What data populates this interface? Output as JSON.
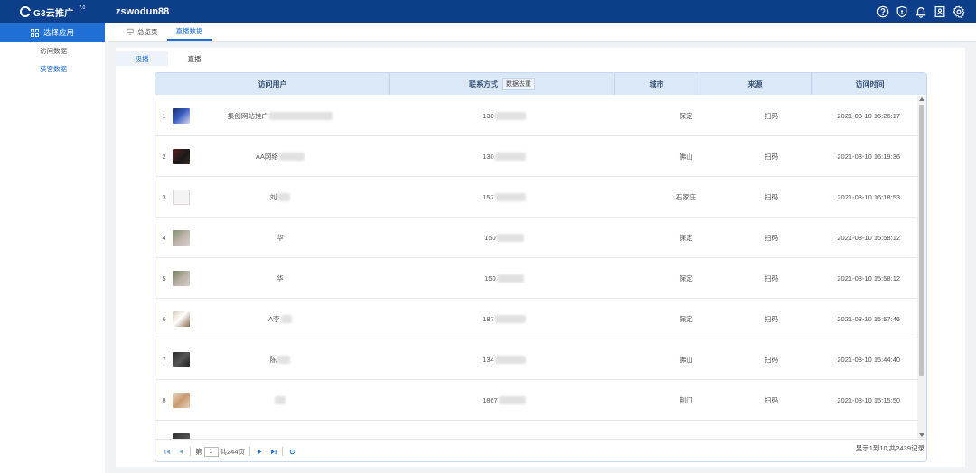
{
  "app": {
    "logo_text": "G3云推广",
    "version": "7.0",
    "account": "zswodun88"
  },
  "header_icons": [
    "help-icon",
    "shield-icon",
    "bell-icon",
    "contacts-icon",
    "gear-icon"
  ],
  "sidebar": {
    "head_label": "选择应用",
    "items": [
      {
        "label": "访问数据",
        "active": false
      },
      {
        "label": "获客数据",
        "active": true
      }
    ]
  },
  "tabs": [
    {
      "label": "总览页",
      "active": false
    },
    {
      "label": "直播数据",
      "active": true
    }
  ],
  "subtabs": [
    {
      "label": "吸播",
      "active": true
    },
    {
      "label": "直播",
      "active": false
    }
  ],
  "table": {
    "columns": {
      "user": "访问用户",
      "contact": "联系方式",
      "dedupe": "数据去重",
      "city": "城市",
      "source": "来源",
      "time": "访问时间"
    },
    "rows": [
      {
        "num": "1",
        "name": "集创网站推广",
        "phone": "130",
        "city": "保定",
        "source": "扫码",
        "time": "2021-03-10 16:26:17"
      },
      {
        "num": "2",
        "name": "AA网络",
        "phone": "130",
        "city": "佛山",
        "source": "扫码",
        "time": "2021-03-10 16:19:36"
      },
      {
        "num": "3",
        "name": "刘",
        "phone": "157",
        "city": "石家庄",
        "source": "扫码",
        "time": "2021-03-10 16:18:53"
      },
      {
        "num": "4",
        "name": "华",
        "phone": "150",
        "city": "保定",
        "source": "扫码",
        "time": "2021-03-10 15:58:12"
      },
      {
        "num": "5",
        "name": "华",
        "phone": "150",
        "city": "保定",
        "source": "扫码",
        "time": "2021-03-10 15:58:12"
      },
      {
        "num": "6",
        "name": "A李",
        "phone": "187",
        "city": "保定",
        "source": "扫码",
        "time": "2021-03-10 15:57:46"
      },
      {
        "num": "7",
        "name": "陈",
        "phone": "134",
        "city": "佛山",
        "source": "扫码",
        "time": "2021-03-10 15:44:40"
      },
      {
        "num": "8",
        "name": "",
        "phone": "1867",
        "city": "荆门",
        "source": "扫码",
        "time": "2021-03-10 15:15:50"
      },
      {
        "num": "",
        "name": "",
        "phone": "",
        "city": "",
        "source": "",
        "time": ""
      }
    ]
  },
  "pager": {
    "page_prefix": "第",
    "page_value": "1",
    "page_total": "共244页",
    "info": "显示1到10,共2439记录"
  }
}
